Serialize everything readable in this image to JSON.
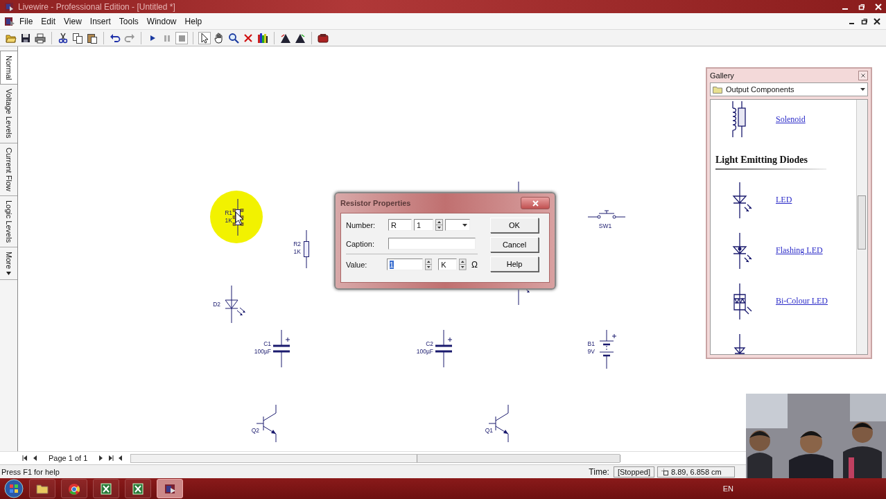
{
  "window": {
    "title": "Livewire - Professional Edition - [Untitled *]"
  },
  "menu": [
    "File",
    "Edit",
    "View",
    "Insert",
    "Tools",
    "Window",
    "Help"
  ],
  "view_tabs": [
    {
      "label": "Normal",
      "selected": true
    },
    {
      "label": "Voltage Levels",
      "selected": false
    },
    {
      "label": "Current Flow",
      "selected": false
    },
    {
      "label": "Logic Levels",
      "selected": false
    },
    {
      "label": "More",
      "selected": false
    }
  ],
  "circuit": {
    "cursor_highlight": true,
    "components": [
      {
        "kind": "resistor",
        "label": "R1",
        "value": "1K",
        "selected": true
      },
      {
        "kind": "resistor",
        "label": "R2",
        "value": "1K",
        "selected": false
      },
      {
        "kind": "led",
        "label": "D2",
        "selected": false
      },
      {
        "kind": "capacitor",
        "label": "C1",
        "value": "100µF",
        "selected": false
      },
      {
        "kind": "capacitor",
        "label": "C2",
        "value": "100µF",
        "selected": false
      },
      {
        "kind": "battery",
        "label": "B1",
        "value": "9V",
        "selected": false
      },
      {
        "kind": "switch",
        "label": "SW1",
        "selected": false
      },
      {
        "kind": "transistor",
        "label": "Q2",
        "selected": false
      },
      {
        "kind": "transistor",
        "label": "Q1",
        "selected": false
      },
      {
        "kind": "resistor"
      },
      {
        "kind": "led"
      }
    ]
  },
  "dialog": {
    "title": "Resistor Properties",
    "number": {
      "label": "Number:",
      "prefix": "R",
      "index": "1"
    },
    "caption": {
      "label": "Caption:"
    },
    "value": {
      "label": "Value:",
      "number": "1",
      "text_selected": true,
      "multiplier": "K",
      "unit": "Ω"
    },
    "buttons": [
      "OK",
      "Cancel",
      "Help"
    ]
  },
  "gallery": {
    "title": "Gallery",
    "category": "Output Components",
    "items": [
      {
        "kind": "solenoid",
        "label": "Solenoid"
      },
      {
        "kind": "heading",
        "label": "Light Emitting Diodes"
      },
      {
        "kind": "led",
        "label": "LED"
      },
      {
        "kind": "flashing_led",
        "label": "Flashing LED"
      },
      {
        "kind": "bicolour_led",
        "label": "Bi-Colour LED"
      },
      {
        "kind": "tricolour_led"
      }
    ]
  },
  "page_nav": {
    "label": "Page 1 of 1"
  },
  "status_bar": {
    "help": "Press F1 for help",
    "time_label": "Time:",
    "time": "[Stopped]",
    "position": "8.89, 6.858 cm"
  },
  "taskbar": {
    "apps": [
      {
        "kind": "folder",
        "selected": false
      },
      {
        "kind": "browser",
        "selected": false
      },
      {
        "kind": "spreadsheet",
        "selected": false
      },
      {
        "kind": "spreadsheet",
        "selected": false
      },
      {
        "kind": "livewire",
        "selected": true
      }
    ],
    "language": "EN"
  }
}
